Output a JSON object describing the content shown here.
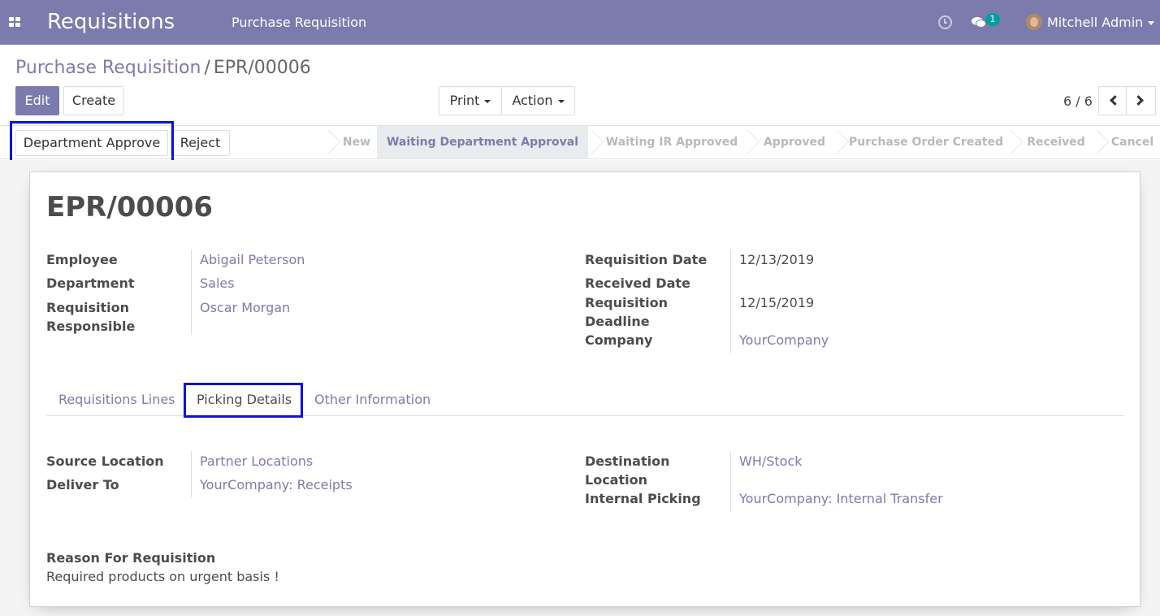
{
  "navbar": {
    "app_title": "Requisitions",
    "menu_item": "Purchase Requisition",
    "chat_badge": "1",
    "user_name": "Mitchell Admin",
    "icons": [
      "apps-grid-icon",
      "clock-icon",
      "chat-icon",
      "avatar"
    ]
  },
  "breadcrumb": {
    "parent": "Purchase Requisition",
    "separator": "/",
    "current": "EPR/00006"
  },
  "toolbar": {
    "edit": "Edit",
    "create": "Create",
    "print": "Print",
    "action": "Action"
  },
  "pager": {
    "value": "6 / 6"
  },
  "status_buttons": {
    "approve": "Department Approve",
    "reject": "Reject"
  },
  "stages": [
    "New",
    "Waiting Department Approval",
    "Waiting IR Approved",
    "Approved",
    "Purchase Order Created",
    "Received",
    "Cancel"
  ],
  "active_stage": "Waiting Department Approval",
  "record": {
    "name": "EPR/00006",
    "left": [
      {
        "label": "Employee",
        "value": "Abigail Peterson"
      },
      {
        "label": "Department",
        "value": "Sales"
      },
      {
        "label_1": "Requisition",
        "label_2": "Responsible",
        "value": "Oscar Morgan"
      }
    ],
    "right": [
      {
        "label": "Requisition Date",
        "value": "12/13/2019"
      },
      {
        "label": "Received Date",
        "value": ""
      },
      {
        "label_1": "Requisition",
        "label_2": "Deadline",
        "value": "12/15/2019"
      },
      {
        "label": "Company",
        "value": "YourCompany"
      }
    ]
  },
  "tabs": [
    "Requisitions Lines",
    "Picking Details",
    "Other Information"
  ],
  "active_tab": "Picking Details",
  "picking": {
    "source_location": {
      "label": "Source Location",
      "value": "Partner Locations"
    },
    "deliver_to": {
      "label": "Deliver To",
      "value": "YourCompany: Receipts"
    },
    "destination": {
      "label_1": "Destination",
      "label_2": "Location",
      "value": "WH/Stock"
    },
    "internal_picking": {
      "label": "Internal Picking",
      "value": "YourCompany: Internal Transfer"
    }
  },
  "reason": {
    "label": "Reason For Requisition",
    "value": "Required products on urgent basis !"
  },
  "colors": {
    "brand": "#7c7bad",
    "highlight": "#1010d8",
    "badge": "#00a09d"
  }
}
